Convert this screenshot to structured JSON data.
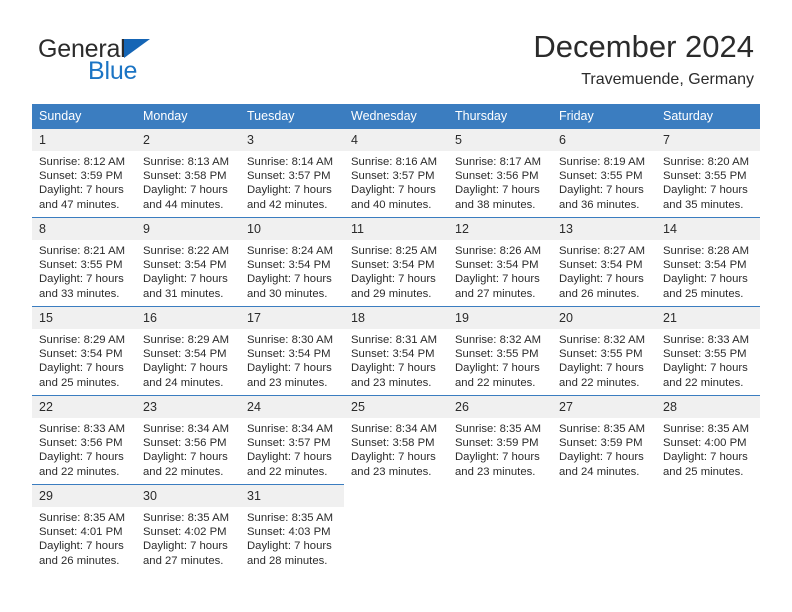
{
  "brand": {
    "line1": "General",
    "line2": "Blue",
    "triangle_icon": "triangle-icon",
    "color_dark": "#2b2b2b",
    "color_blue": "#1b74c4"
  },
  "header": {
    "title": "December 2024",
    "location": "Travemuende, Germany"
  },
  "theme": {
    "header_bg": "#3b7dc0",
    "header_text": "#ffffff",
    "daynum_bg": "#f0f0f0",
    "cell_bg": "#ffffff",
    "text": "#2b2b2b"
  },
  "weekday_headers": [
    "Sunday",
    "Monday",
    "Tuesday",
    "Wednesday",
    "Thursday",
    "Friday",
    "Saturday"
  ],
  "weeks": [
    [
      {
        "day": "1",
        "sunrise": "Sunrise: 8:12 AM",
        "sunset": "Sunset: 3:59 PM",
        "daylight1": "Daylight: 7 hours",
        "daylight2": "and 47 minutes."
      },
      {
        "day": "2",
        "sunrise": "Sunrise: 8:13 AM",
        "sunset": "Sunset: 3:58 PM",
        "daylight1": "Daylight: 7 hours",
        "daylight2": "and 44 minutes."
      },
      {
        "day": "3",
        "sunrise": "Sunrise: 8:14 AM",
        "sunset": "Sunset: 3:57 PM",
        "daylight1": "Daylight: 7 hours",
        "daylight2": "and 42 minutes."
      },
      {
        "day": "4",
        "sunrise": "Sunrise: 8:16 AM",
        "sunset": "Sunset: 3:57 PM",
        "daylight1": "Daylight: 7 hours",
        "daylight2": "and 40 minutes."
      },
      {
        "day": "5",
        "sunrise": "Sunrise: 8:17 AM",
        "sunset": "Sunset: 3:56 PM",
        "daylight1": "Daylight: 7 hours",
        "daylight2": "and 38 minutes."
      },
      {
        "day": "6",
        "sunrise": "Sunrise: 8:19 AM",
        "sunset": "Sunset: 3:55 PM",
        "daylight1": "Daylight: 7 hours",
        "daylight2": "and 36 minutes."
      },
      {
        "day": "7",
        "sunrise": "Sunrise: 8:20 AM",
        "sunset": "Sunset: 3:55 PM",
        "daylight1": "Daylight: 7 hours",
        "daylight2": "and 35 minutes."
      }
    ],
    [
      {
        "day": "8",
        "sunrise": "Sunrise: 8:21 AM",
        "sunset": "Sunset: 3:55 PM",
        "daylight1": "Daylight: 7 hours",
        "daylight2": "and 33 minutes."
      },
      {
        "day": "9",
        "sunrise": "Sunrise: 8:22 AM",
        "sunset": "Sunset: 3:54 PM",
        "daylight1": "Daylight: 7 hours",
        "daylight2": "and 31 minutes."
      },
      {
        "day": "10",
        "sunrise": "Sunrise: 8:24 AM",
        "sunset": "Sunset: 3:54 PM",
        "daylight1": "Daylight: 7 hours",
        "daylight2": "and 30 minutes."
      },
      {
        "day": "11",
        "sunrise": "Sunrise: 8:25 AM",
        "sunset": "Sunset: 3:54 PM",
        "daylight1": "Daylight: 7 hours",
        "daylight2": "and 29 minutes."
      },
      {
        "day": "12",
        "sunrise": "Sunrise: 8:26 AM",
        "sunset": "Sunset: 3:54 PM",
        "daylight1": "Daylight: 7 hours",
        "daylight2": "and 27 minutes."
      },
      {
        "day": "13",
        "sunrise": "Sunrise: 8:27 AM",
        "sunset": "Sunset: 3:54 PM",
        "daylight1": "Daylight: 7 hours",
        "daylight2": "and 26 minutes."
      },
      {
        "day": "14",
        "sunrise": "Sunrise: 8:28 AM",
        "sunset": "Sunset: 3:54 PM",
        "daylight1": "Daylight: 7 hours",
        "daylight2": "and 25 minutes."
      }
    ],
    [
      {
        "day": "15",
        "sunrise": "Sunrise: 8:29 AM",
        "sunset": "Sunset: 3:54 PM",
        "daylight1": "Daylight: 7 hours",
        "daylight2": "and 25 minutes."
      },
      {
        "day": "16",
        "sunrise": "Sunrise: 8:29 AM",
        "sunset": "Sunset: 3:54 PM",
        "daylight1": "Daylight: 7 hours",
        "daylight2": "and 24 minutes."
      },
      {
        "day": "17",
        "sunrise": "Sunrise: 8:30 AM",
        "sunset": "Sunset: 3:54 PM",
        "daylight1": "Daylight: 7 hours",
        "daylight2": "and 23 minutes."
      },
      {
        "day": "18",
        "sunrise": "Sunrise: 8:31 AM",
        "sunset": "Sunset: 3:54 PM",
        "daylight1": "Daylight: 7 hours",
        "daylight2": "and 23 minutes."
      },
      {
        "day": "19",
        "sunrise": "Sunrise: 8:32 AM",
        "sunset": "Sunset: 3:55 PM",
        "daylight1": "Daylight: 7 hours",
        "daylight2": "and 22 minutes."
      },
      {
        "day": "20",
        "sunrise": "Sunrise: 8:32 AM",
        "sunset": "Sunset: 3:55 PM",
        "daylight1": "Daylight: 7 hours",
        "daylight2": "and 22 minutes."
      },
      {
        "day": "21",
        "sunrise": "Sunrise: 8:33 AM",
        "sunset": "Sunset: 3:55 PM",
        "daylight1": "Daylight: 7 hours",
        "daylight2": "and 22 minutes."
      }
    ],
    [
      {
        "day": "22",
        "sunrise": "Sunrise: 8:33 AM",
        "sunset": "Sunset: 3:56 PM",
        "daylight1": "Daylight: 7 hours",
        "daylight2": "and 22 minutes."
      },
      {
        "day": "23",
        "sunrise": "Sunrise: 8:34 AM",
        "sunset": "Sunset: 3:56 PM",
        "daylight1": "Daylight: 7 hours",
        "daylight2": "and 22 minutes."
      },
      {
        "day": "24",
        "sunrise": "Sunrise: 8:34 AM",
        "sunset": "Sunset: 3:57 PM",
        "daylight1": "Daylight: 7 hours",
        "daylight2": "and 22 minutes."
      },
      {
        "day": "25",
        "sunrise": "Sunrise: 8:34 AM",
        "sunset": "Sunset: 3:58 PM",
        "daylight1": "Daylight: 7 hours",
        "daylight2": "and 23 minutes."
      },
      {
        "day": "26",
        "sunrise": "Sunrise: 8:35 AM",
        "sunset": "Sunset: 3:59 PM",
        "daylight1": "Daylight: 7 hours",
        "daylight2": "and 23 minutes."
      },
      {
        "day": "27",
        "sunrise": "Sunrise: 8:35 AM",
        "sunset": "Sunset: 3:59 PM",
        "daylight1": "Daylight: 7 hours",
        "daylight2": "and 24 minutes."
      },
      {
        "day": "28",
        "sunrise": "Sunrise: 8:35 AM",
        "sunset": "Sunset: 4:00 PM",
        "daylight1": "Daylight: 7 hours",
        "daylight2": "and 25 minutes."
      }
    ],
    [
      {
        "day": "29",
        "sunrise": "Sunrise: 8:35 AM",
        "sunset": "Sunset: 4:01 PM",
        "daylight1": "Daylight: 7 hours",
        "daylight2": "and 26 minutes."
      },
      {
        "day": "30",
        "sunrise": "Sunrise: 8:35 AM",
        "sunset": "Sunset: 4:02 PM",
        "daylight1": "Daylight: 7 hours",
        "daylight2": "and 27 minutes."
      },
      {
        "day": "31",
        "sunrise": "Sunrise: 8:35 AM",
        "sunset": "Sunset: 4:03 PM",
        "daylight1": "Daylight: 7 hours",
        "daylight2": "and 28 minutes."
      },
      {
        "day": "",
        "sunrise": "",
        "sunset": "",
        "daylight1": "",
        "daylight2": ""
      },
      {
        "day": "",
        "sunrise": "",
        "sunset": "",
        "daylight1": "",
        "daylight2": ""
      },
      {
        "day": "",
        "sunrise": "",
        "sunset": "",
        "daylight1": "",
        "daylight2": ""
      },
      {
        "day": "",
        "sunrise": "",
        "sunset": "",
        "daylight1": "",
        "daylight2": ""
      }
    ]
  ]
}
